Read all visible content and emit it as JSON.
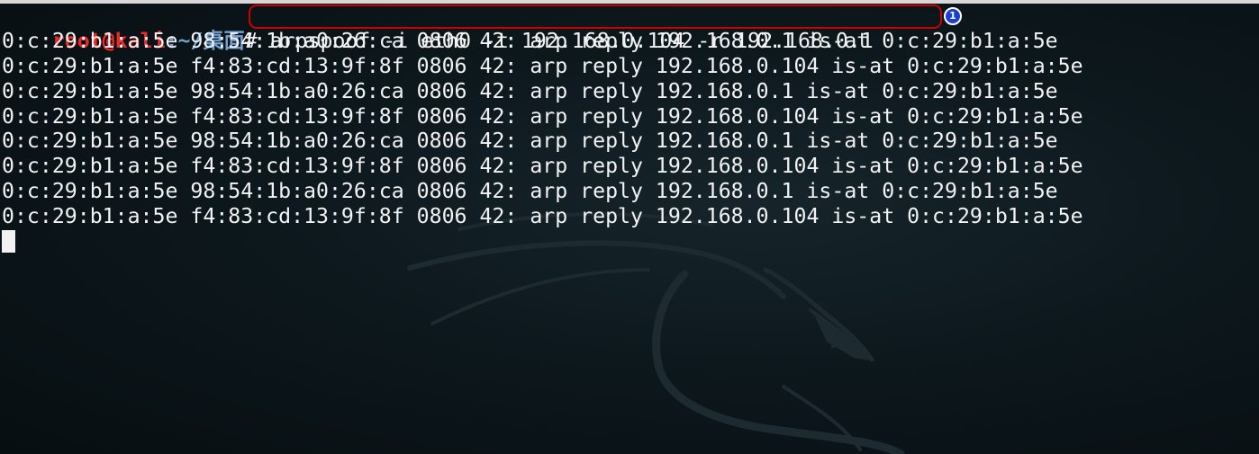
{
  "prompt": {
    "user_host": "root@kali",
    "path": ":~/桌面",
    "symbol": "# ",
    "command": "arpspoof -i eth0 -t 192.168.0.104 -r 192.168.0.1"
  },
  "annotation": {
    "badge_number": "1",
    "color": "#cc0000",
    "badge_color": "#1a3fd1"
  },
  "output_lines": [
    "0:c:29:b1:a:5e 98:54:1b:a0:26:ca 0806 42: arp reply 192.168.0.1 is-at 0:c:29:b1:a:5e",
    "0:c:29:b1:a:5e f4:83:cd:13:9f:8f 0806 42: arp reply 192.168.0.104 is-at 0:c:29:b1:a:5e",
    "0:c:29:b1:a:5e 98:54:1b:a0:26:ca 0806 42: arp reply 192.168.0.1 is-at 0:c:29:b1:a:5e",
    "0:c:29:b1:a:5e f4:83:cd:13:9f:8f 0806 42: arp reply 192.168.0.104 is-at 0:c:29:b1:a:5e",
    "0:c:29:b1:a:5e 98:54:1b:a0:26:ca 0806 42: arp reply 192.168.0.1 is-at 0:c:29:b1:a:5e",
    "0:c:29:b1:a:5e f4:83:cd:13:9f:8f 0806 42: arp reply 192.168.0.104 is-at 0:c:29:b1:a:5e",
    "0:c:29:b1:a:5e 98:54:1b:a0:26:ca 0806 42: arp reply 192.168.0.1 is-at 0:c:29:b1:a:5e",
    "0:c:29:b1:a:5e f4:83:cd:13:9f:8f 0806 42: arp reply 192.168.0.104 is-at 0:c:29:b1:a:5e"
  ],
  "colors": {
    "background": "#0b1418",
    "text": "#f2f2f2",
    "prompt_user": "#ef2929",
    "prompt_path": "#729fcf"
  },
  "icons": {
    "background_watermark": "kali-dragon-icon"
  }
}
